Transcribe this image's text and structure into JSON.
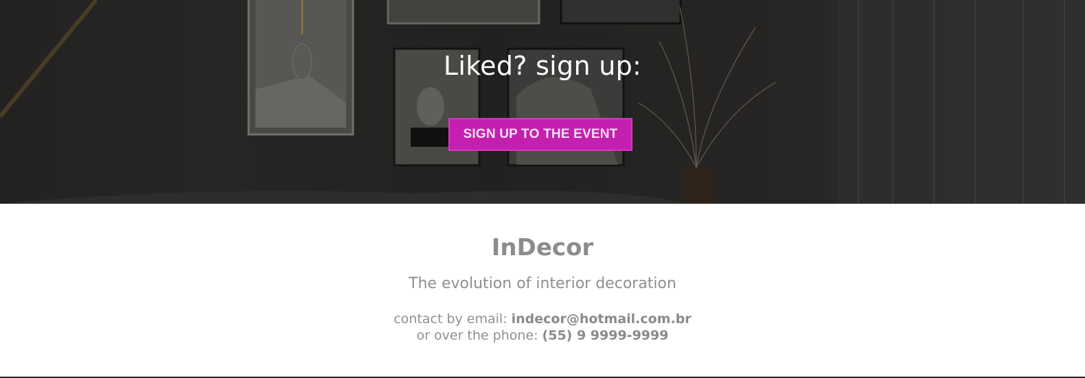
{
  "hero": {
    "heading": "Liked? sign up:",
    "cta_label": "SIGN UP TO THE EVENT"
  },
  "footer": {
    "brand": "InDecor",
    "tagline": "The evolution of interior decoration",
    "email_prefix": "contact by email: ",
    "email": "indecor@hotmail.com.br",
    "phone_prefix": "or over the phone: ",
    "phone": "(55) 9 9999-9999"
  },
  "colors": {
    "accent": "#c51fb0",
    "footer_text": "#8f8f91",
    "hero_bg": "#2e2d2b"
  }
}
